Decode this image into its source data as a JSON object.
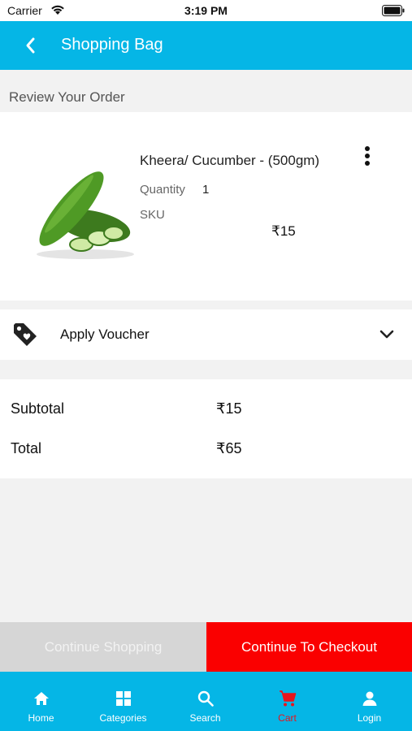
{
  "status_bar": {
    "carrier": "Carrier",
    "time": "3:19 PM"
  },
  "nav": {
    "title": "Shopping Bag",
    "back_icon": "chevron-left-icon"
  },
  "review": {
    "heading": "Review Your Order"
  },
  "product": {
    "name": "Kheera/ Cucumber -  (500gm)",
    "quantity_label": "Quantity",
    "quantity_value": "1",
    "sku_label": "SKU",
    "price": "₹15",
    "image": "cucumber-image",
    "menu_icon": "more-vertical-icon"
  },
  "voucher": {
    "label": "Apply Voucher",
    "icon": "tag-icon",
    "chevron": "chevron-down-icon"
  },
  "totals": {
    "subtotal_label": "Subtotal",
    "subtotal_value": "₹15",
    "total_label": "Total",
    "total_value": "₹65"
  },
  "actions": {
    "continue_shopping": "Continue Shopping",
    "continue_checkout": "Continue To Checkout"
  },
  "tabs": [
    {
      "label": "Home",
      "icon": "home-icon"
    },
    {
      "label": "Categories",
      "icon": "grid-icon"
    },
    {
      "label": "Search",
      "icon": "search-icon"
    },
    {
      "label": "Cart",
      "icon": "cart-icon",
      "active": true
    },
    {
      "label": "Login",
      "icon": "user-icon"
    }
  ],
  "colors": {
    "primary": "#05b6e6",
    "checkout": "#fa0000",
    "continue": "#d6d6d6",
    "active_tab": "#e8141c"
  }
}
